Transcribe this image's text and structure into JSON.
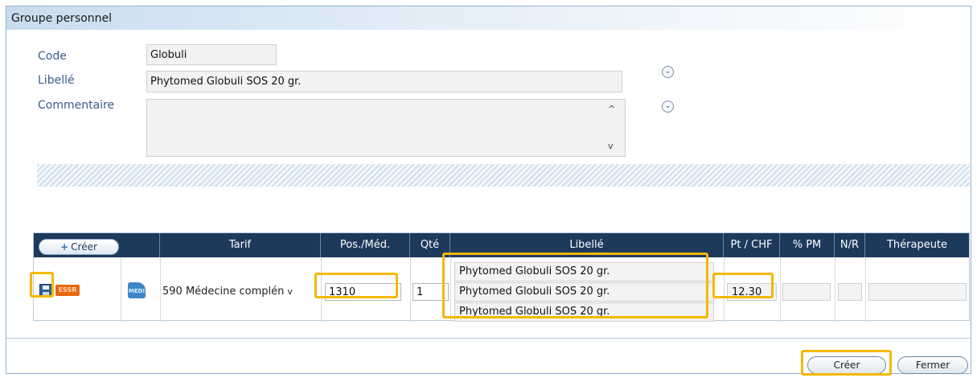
{
  "window": {
    "title": "Groupe personnel"
  },
  "form": {
    "code_label": "Code",
    "code_value": "Globuli",
    "libelle_label": "Libellé",
    "libelle_value": "Phytomed Globuli SOS 20 gr.",
    "commentaire_label": "Commentaire",
    "commentaire_value": "",
    "expand_glyph": "⌄"
  },
  "grid": {
    "create_button": "Créer",
    "columns": [
      "Tarif",
      "Pos./Méd.",
      "Qté",
      "Libellé",
      "Pt / CHF",
      "% PM",
      "N/R",
      "Thérapeute"
    ],
    "row": {
      "tarif": "590 Médecine complén",
      "position": "1310",
      "quantity": "1",
      "libelle_lines": [
        "Phytomed Globuli SOS 20 gr.",
        "Phytomed Globuli SOS 20 gr.",
        "Phytomed Globuli SOS 20 gr."
      ],
      "price": "12.30",
      "pm": "",
      "nr": "",
      "therapeute": "",
      "cancel_icon_text": "ESSR",
      "alt_icon_text": "MEDI"
    }
  },
  "footer": {
    "create_label": "Créer",
    "close_label": "Fermer"
  },
  "colors": {
    "highlight": "#f5b800",
    "header": "#1d3a5c",
    "label": "#3a5d8f"
  }
}
